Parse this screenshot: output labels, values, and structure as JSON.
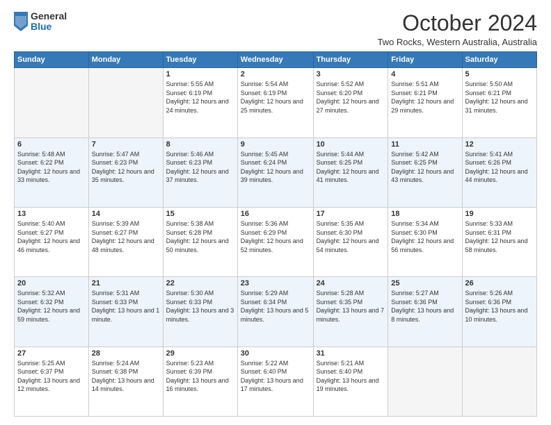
{
  "logo": {
    "general": "General",
    "blue": "Blue"
  },
  "title": "October 2024",
  "location": "Two Rocks, Western Australia, Australia",
  "days_of_week": [
    "Sunday",
    "Monday",
    "Tuesday",
    "Wednesday",
    "Thursday",
    "Friday",
    "Saturday"
  ],
  "weeks": [
    [
      {
        "day": "",
        "info": ""
      },
      {
        "day": "",
        "info": ""
      },
      {
        "day": "1",
        "info": "Sunrise: 5:55 AM\nSunset: 6:19 PM\nDaylight: 12 hours and 24 minutes."
      },
      {
        "day": "2",
        "info": "Sunrise: 5:54 AM\nSunset: 6:19 PM\nDaylight: 12 hours and 25 minutes."
      },
      {
        "day": "3",
        "info": "Sunrise: 5:52 AM\nSunset: 6:20 PM\nDaylight: 12 hours and 27 minutes."
      },
      {
        "day": "4",
        "info": "Sunrise: 5:51 AM\nSunset: 6:21 PM\nDaylight: 12 hours and 29 minutes."
      },
      {
        "day": "5",
        "info": "Sunrise: 5:50 AM\nSunset: 6:21 PM\nDaylight: 12 hours and 31 minutes."
      }
    ],
    [
      {
        "day": "6",
        "info": "Sunrise: 5:48 AM\nSunset: 6:22 PM\nDaylight: 12 hours and 33 minutes."
      },
      {
        "day": "7",
        "info": "Sunrise: 5:47 AM\nSunset: 6:23 PM\nDaylight: 12 hours and 35 minutes."
      },
      {
        "day": "8",
        "info": "Sunrise: 5:46 AM\nSunset: 6:23 PM\nDaylight: 12 hours and 37 minutes."
      },
      {
        "day": "9",
        "info": "Sunrise: 5:45 AM\nSunset: 6:24 PM\nDaylight: 12 hours and 39 minutes."
      },
      {
        "day": "10",
        "info": "Sunrise: 5:44 AM\nSunset: 6:25 PM\nDaylight: 12 hours and 41 minutes."
      },
      {
        "day": "11",
        "info": "Sunrise: 5:42 AM\nSunset: 6:25 PM\nDaylight: 12 hours and 43 minutes."
      },
      {
        "day": "12",
        "info": "Sunrise: 5:41 AM\nSunset: 6:26 PM\nDaylight: 12 hours and 44 minutes."
      }
    ],
    [
      {
        "day": "13",
        "info": "Sunrise: 5:40 AM\nSunset: 6:27 PM\nDaylight: 12 hours and 46 minutes."
      },
      {
        "day": "14",
        "info": "Sunrise: 5:39 AM\nSunset: 6:27 PM\nDaylight: 12 hours and 48 minutes."
      },
      {
        "day": "15",
        "info": "Sunrise: 5:38 AM\nSunset: 6:28 PM\nDaylight: 12 hours and 50 minutes."
      },
      {
        "day": "16",
        "info": "Sunrise: 5:36 AM\nSunset: 6:29 PM\nDaylight: 12 hours and 52 minutes."
      },
      {
        "day": "17",
        "info": "Sunrise: 5:35 AM\nSunset: 6:30 PM\nDaylight: 12 hours and 54 minutes."
      },
      {
        "day": "18",
        "info": "Sunrise: 5:34 AM\nSunset: 6:30 PM\nDaylight: 12 hours and 56 minutes."
      },
      {
        "day": "19",
        "info": "Sunrise: 5:33 AM\nSunset: 6:31 PM\nDaylight: 12 hours and 58 minutes."
      }
    ],
    [
      {
        "day": "20",
        "info": "Sunrise: 5:32 AM\nSunset: 6:32 PM\nDaylight: 12 hours and 59 minutes."
      },
      {
        "day": "21",
        "info": "Sunrise: 5:31 AM\nSunset: 6:33 PM\nDaylight: 13 hours and 1 minute."
      },
      {
        "day": "22",
        "info": "Sunrise: 5:30 AM\nSunset: 6:33 PM\nDaylight: 13 hours and 3 minutes."
      },
      {
        "day": "23",
        "info": "Sunrise: 5:29 AM\nSunset: 6:34 PM\nDaylight: 13 hours and 5 minutes."
      },
      {
        "day": "24",
        "info": "Sunrise: 5:28 AM\nSunset: 6:35 PM\nDaylight: 13 hours and 7 minutes."
      },
      {
        "day": "25",
        "info": "Sunrise: 5:27 AM\nSunset: 6:36 PM\nDaylight: 13 hours and 8 minutes."
      },
      {
        "day": "26",
        "info": "Sunrise: 5:26 AM\nSunset: 6:36 PM\nDaylight: 13 hours and 10 minutes."
      }
    ],
    [
      {
        "day": "27",
        "info": "Sunrise: 5:25 AM\nSunset: 6:37 PM\nDaylight: 13 hours and 12 minutes."
      },
      {
        "day": "28",
        "info": "Sunrise: 5:24 AM\nSunset: 6:38 PM\nDaylight: 13 hours and 14 minutes."
      },
      {
        "day": "29",
        "info": "Sunrise: 5:23 AM\nSunset: 6:39 PM\nDaylight: 13 hours and 16 minutes."
      },
      {
        "day": "30",
        "info": "Sunrise: 5:22 AM\nSunset: 6:40 PM\nDaylight: 13 hours and 17 minutes."
      },
      {
        "day": "31",
        "info": "Sunrise: 5:21 AM\nSunset: 6:40 PM\nDaylight: 13 hours and 19 minutes."
      },
      {
        "day": "",
        "info": ""
      },
      {
        "day": "",
        "info": ""
      }
    ]
  ]
}
